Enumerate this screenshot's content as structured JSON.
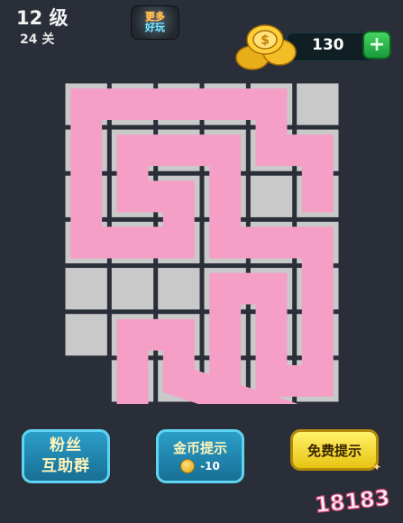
{
  "header": {
    "level_title": "12 级",
    "level_sub": "24 关",
    "more_games": [
      "更多",
      "好玩"
    ],
    "coins": "130"
  },
  "board": {
    "cols": 6,
    "rows": 7,
    "blocked_cells": [
      [
        6,
        0
      ]
    ],
    "path": [
      [
        2,
        5
      ],
      [
        1,
        5
      ],
      [
        1,
        4
      ],
      [
        0,
        4
      ],
      [
        0,
        3
      ],
      [
        0,
        2
      ],
      [
        0,
        1
      ],
      [
        0,
        0
      ],
      [
        1,
        0
      ],
      [
        2,
        0
      ],
      [
        3,
        0
      ],
      [
        3,
        1
      ],
      [
        3,
        2
      ],
      [
        2,
        2
      ],
      [
        2,
        1
      ],
      [
        1,
        1
      ],
      [
        1,
        2
      ],
      [
        1,
        3
      ],
      [
        2,
        3
      ],
      [
        3,
        3
      ],
      [
        3,
        4
      ],
      [
        3,
        5
      ],
      [
        4,
        5
      ],
      [
        5,
        5
      ],
      [
        6,
        5
      ],
      [
        6,
        4
      ],
      [
        5,
        4
      ],
      [
        4,
        4
      ],
      [
        4,
        3
      ],
      [
        5,
        3
      ],
      [
        6,
        3
      ],
      [
        7,
        3
      ],
      [
        7,
        4
      ],
      [
        7,
        5
      ],
      [
        6,
        2
      ],
      [
        5,
        2
      ],
      [
        5,
        1
      ],
      [
        6,
        1
      ],
      [
        7,
        1
      ],
      [
        7,
        0
      ]
    ],
    "colors": {
      "path": "#f59fc6",
      "cell": "#c9c9c9",
      "frame": "#2a2e39"
    }
  },
  "buttons": {
    "fans_line1": "粉丝",
    "fans_line2": "互助群",
    "gold_hint": "金币提示",
    "gold_hint_cost": "-10",
    "free_hint": "免费提示"
  },
  "watermark": "18183"
}
